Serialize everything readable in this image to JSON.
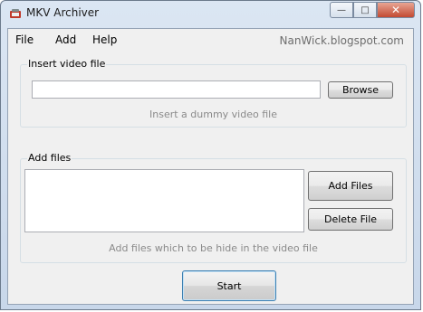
{
  "window": {
    "title": "MKV Archiver",
    "minimize_glyph": "—",
    "maximize_glyph": "□",
    "close_glyph": "✕"
  },
  "menu": {
    "items": [
      {
        "label": "File"
      },
      {
        "label": "Add"
      },
      {
        "label": "Help"
      }
    ],
    "site": "NanWick.blogspot.com"
  },
  "video_group": {
    "legend": "Insert video file",
    "path_value": "",
    "browse_label": "Browse",
    "hint": "Insert a dummy video file"
  },
  "files_group": {
    "legend": "Add files",
    "files": [],
    "add_label": "Add Files",
    "delete_label": "Delete File",
    "hint": "Add files which to be hide in the video file"
  },
  "actions": {
    "start_label": "Start"
  },
  "icons": {
    "app": "mkv-app-icon"
  }
}
